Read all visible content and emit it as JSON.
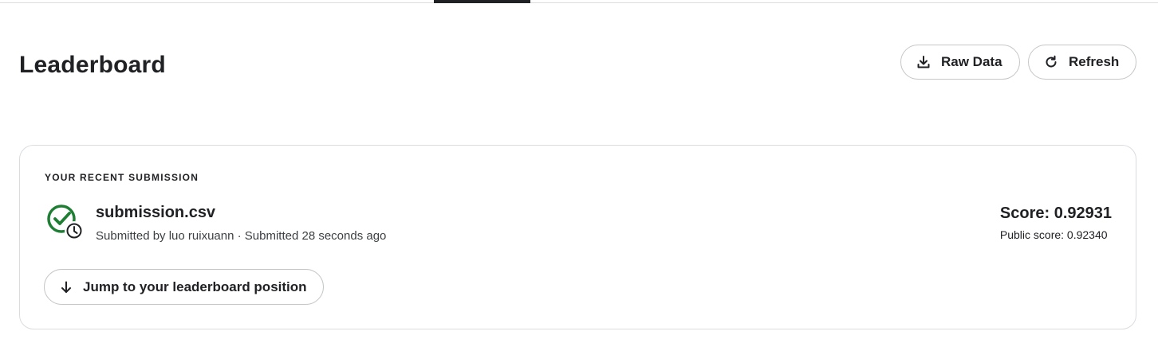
{
  "header": {
    "title": "Leaderboard",
    "raw_data_label": "Raw Data",
    "refresh_label": "Refresh"
  },
  "submission": {
    "section_label": "YOUR RECENT SUBMISSION",
    "file_name": "submission.csv",
    "meta": "Submitted by luo ruixuann · Submitted 28 seconds ago",
    "score": "Score: 0.92931",
    "public_score": "Public score: 0.92340",
    "jump_label": "Jump to your leaderboard position",
    "status_icon": "check-circle-pending-icon"
  },
  "icons": {
    "download": "download-icon",
    "refresh": "refresh-icon",
    "arrow_down": "arrow-down-icon"
  },
  "colors": {
    "success": "#1e7e34",
    "text": "#202124",
    "border": "#dadce0"
  }
}
